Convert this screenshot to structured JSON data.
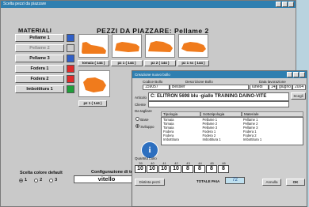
{
  "win1": {
    "title": "Scelta pezzi da piazzare",
    "materials_header": "MATERIALI",
    "pieces_header": "PEZZI DA PIAZZARE: Pellame 2",
    "materials": [
      {
        "label": "Pellame 1",
        "enabled": true,
        "color": "#2f5fc8"
      },
      {
        "label": "Pellame 2",
        "enabled": false,
        "color": "#cccccc"
      },
      {
        "label": "Pellame 3",
        "enabled": true,
        "color": "#2f5fc8"
      },
      {
        "label": "Fodera 1",
        "enabled": true,
        "color": "#e02a2a"
      },
      {
        "label": "Fodera 2",
        "enabled": true,
        "color": "#e02a2a"
      },
      {
        "label": "Imbottitura 1",
        "enabled": true,
        "color": "#1f9f3a"
      }
    ],
    "pieces": [
      {
        "label": "tomaia ( 144 )"
      },
      {
        "label": "pz 1 ( 144 )"
      },
      {
        "label": "pz 2 ( 144 )"
      },
      {
        "label": "pz 1 sc ( 144 )"
      },
      {
        "label": "pz 1 ( 144 )"
      }
    ],
    "piece_color": "#f07b1c",
    "scelta_label": "Scelta colore default",
    "radio": [
      {
        "label": "1",
        "checked": true
      },
      {
        "label": "2",
        "checked": false
      },
      {
        "label": "3",
        "checked": false
      }
    ],
    "config_label": "Configurazione di to",
    "config_value": "vitello"
  },
  "win2": {
    "title": "Creazione nuovo bollo",
    "codice_label": "Codice Bollo",
    "descr_label": "Descrizione Bollo",
    "data_label": "Data lavorazione",
    "codice_value": "159057",
    "descr_value": "Bessler",
    "date_day": "lunedì",
    "date_num": "14",
    "date_month": "giugno",
    "date_year": "2004",
    "articolo_label": "Articolo",
    "articolo_value": "C:  ELITRON   5698 blu -giallo   TRAINING DAINO-VITE",
    "scegli_label": "Scegli",
    "cliente_label": "Cliente",
    "da_tagliare_label": "Da tagliare",
    "opt1": "Base",
    "opt2": "Sviluppo",
    "grid_headers": [
      "Tipologia",
      "Sottotipologia",
      "Materiale"
    ],
    "grid_rows": [
      [
        "Tomaia",
        "Pellame 1",
        "Pellame 1"
      ],
      [
        "Tomaia",
        "Pellame 2",
        "Pellame 2"
      ],
      [
        "Tomaia",
        "Pellame 3",
        "Pellame 3"
      ],
      [
        "Fodera",
        "Fodera 1",
        "Fodera 1"
      ],
      [
        "Fodera",
        "Fodera 2",
        "Fodera 2"
      ],
      [
        "Imbottitura",
        "Imbottitura 1",
        "Imbottitura 1"
      ]
    ],
    "quantity_label": "Quantità bollo",
    "sizes": [
      "39",
      "40",
      "41",
      "42",
      "43",
      "44",
      "45",
      "46"
    ],
    "quantities": [
      "10",
      "10",
      "10",
      "10",
      "8",
      "8",
      "8",
      "8"
    ],
    "distinta_label": "Distinta pezzi",
    "totale_label": "TOTALE PAIA",
    "totale_value": "72",
    "annulla_label": "Annulla",
    "ok_label": "OK"
  }
}
